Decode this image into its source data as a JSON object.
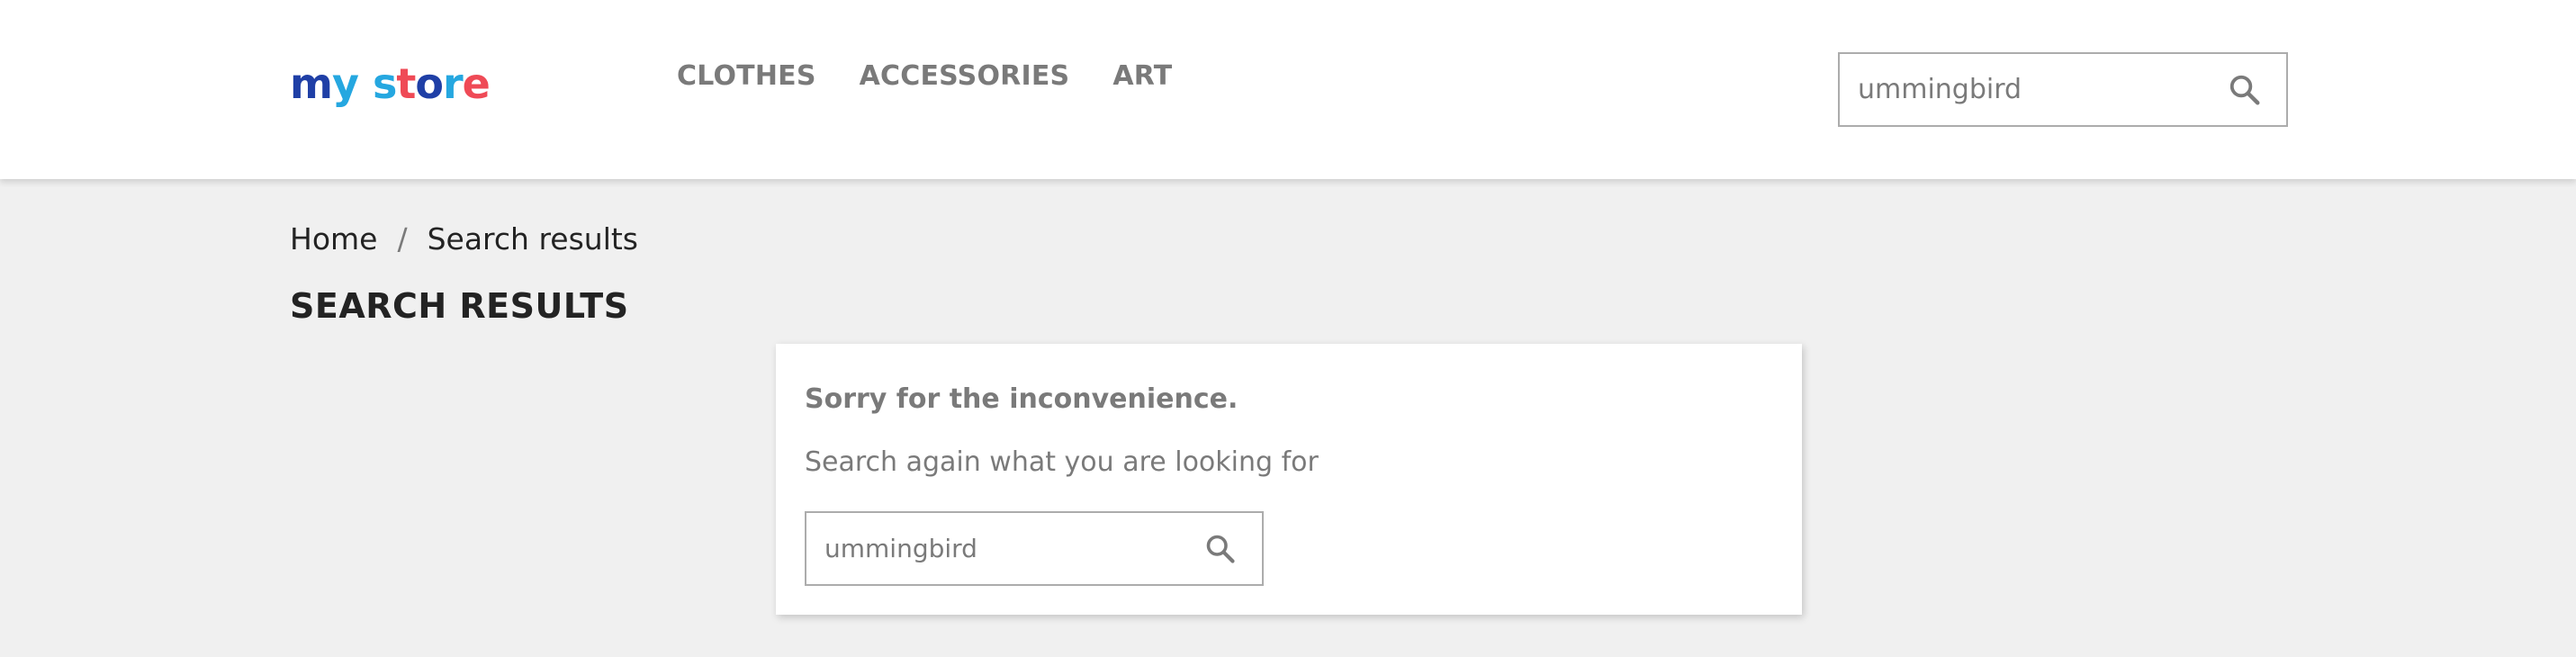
{
  "logo": {
    "text": "my store",
    "letters": [
      {
        "char": "m",
        "color": "#1f3fa6"
      },
      {
        "char": "y",
        "color": "#25a7e0"
      },
      {
        "char": "s",
        "color": "#25a7e0"
      },
      {
        "char": "t",
        "color": "#ef4a56"
      },
      {
        "char": "o",
        "color": "#1f3fa6"
      },
      {
        "char": "r",
        "color": "#25a7e0"
      },
      {
        "char": "e",
        "color": "#ef4a56"
      }
    ]
  },
  "nav": {
    "items": [
      "Clothes",
      "Accessories",
      "Art"
    ]
  },
  "header_search": {
    "value": "ummingbird",
    "icon": "search-icon"
  },
  "breadcrumb": {
    "items": [
      "Home",
      "Search results"
    ],
    "separator": "/"
  },
  "page": {
    "title": "Search results"
  },
  "notice": {
    "title": "Sorry for the inconvenience.",
    "subtitle": "Search again what you are looking for",
    "search_value": "ummingbird",
    "icon": "search-icon"
  },
  "colors": {
    "header_bg": "#ffffff",
    "page_bg": "#f0f0f0",
    "text_dark": "#232323",
    "text_muted": "#7a7a7a",
    "input_border": "#acacac"
  }
}
